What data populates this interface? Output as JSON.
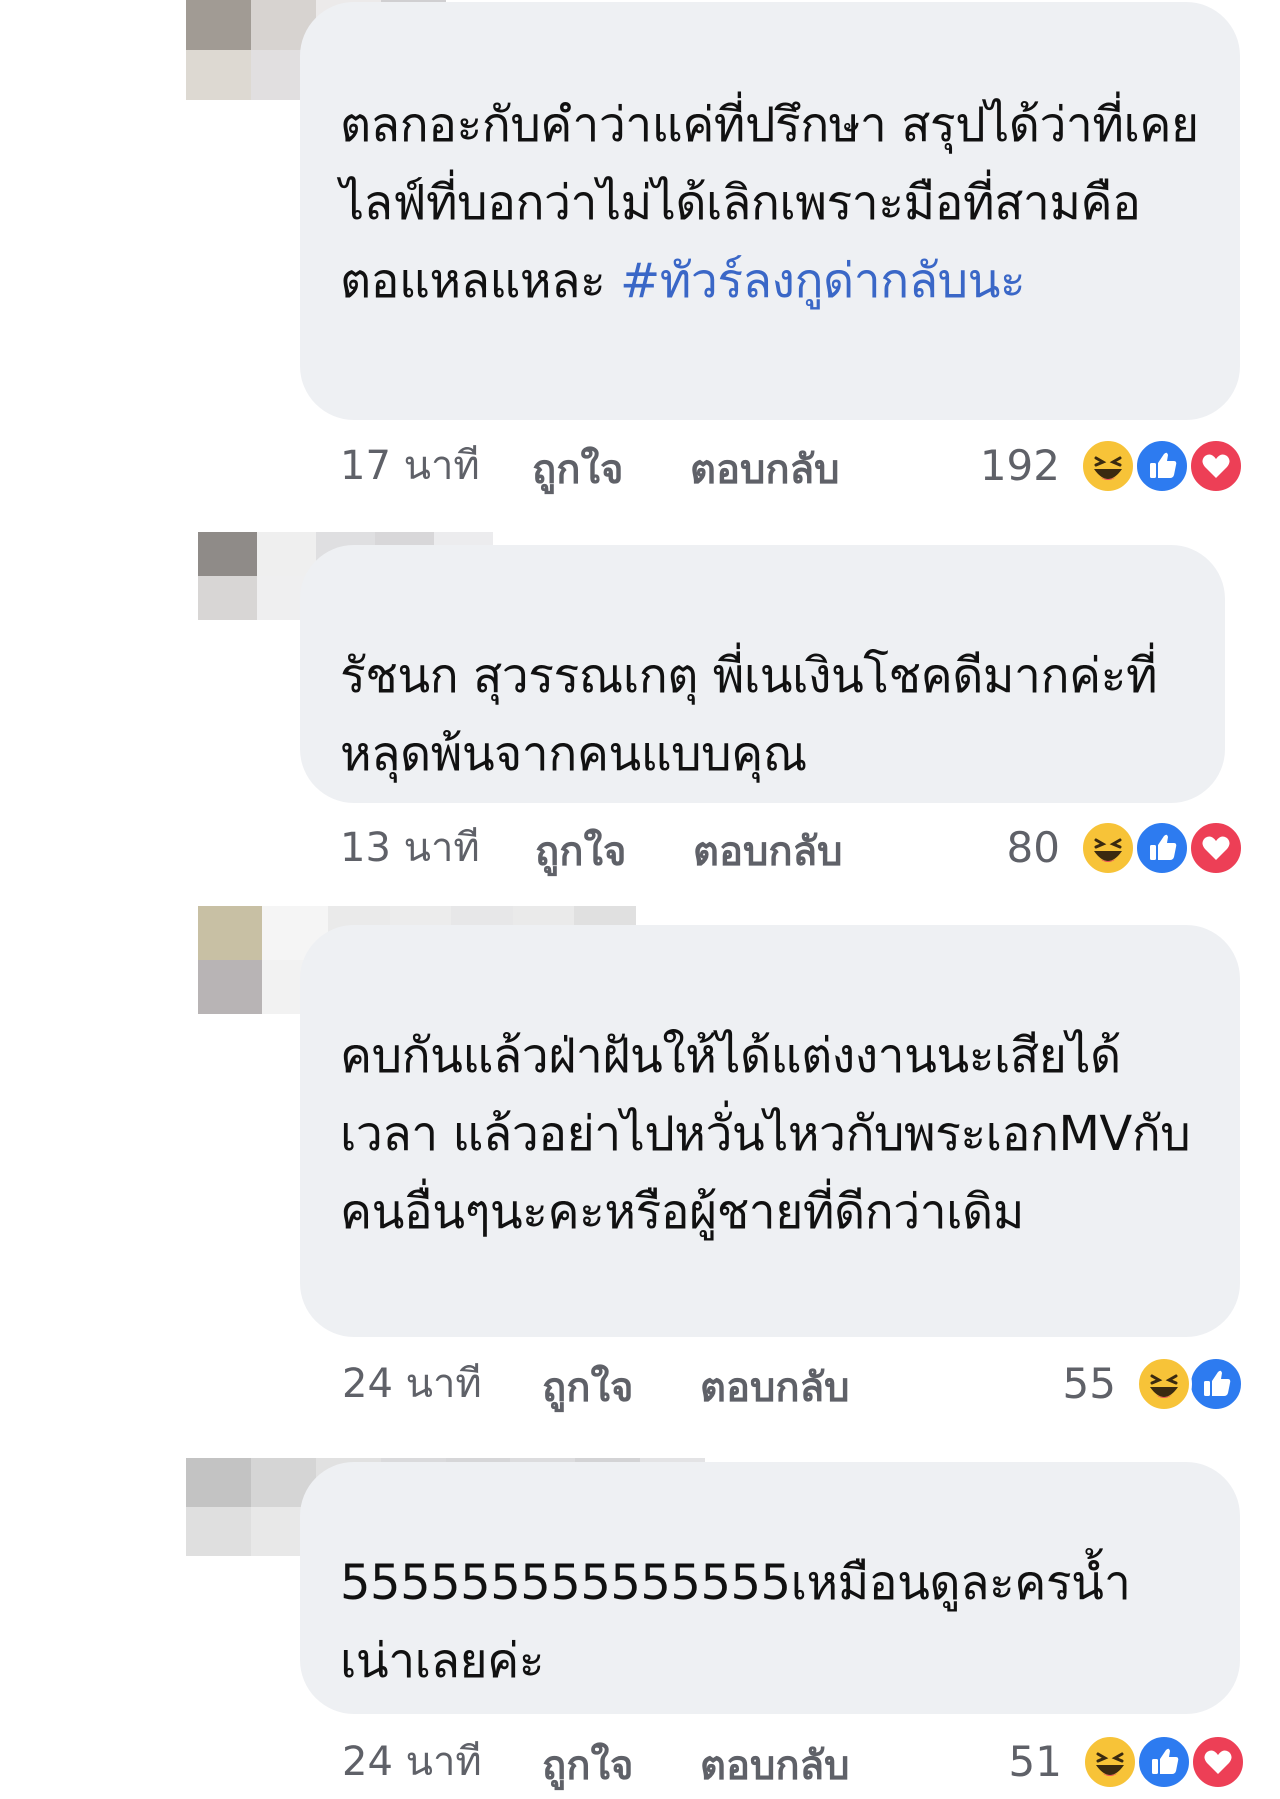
{
  "colors": {
    "bubble": "#eef0f3",
    "text": "#111111",
    "meta": "#5f6168",
    "hashtag": "#3a67c7",
    "haha": "#f7c338",
    "like": "#2d7bf0",
    "love": "#ed3f56"
  },
  "comments": [
    {
      "name_pixel_blocks": [
        "#a19b94",
        "#d7d3d0",
        "#eceaea",
        "#d0cfd1",
        "#ddd9d2",
        "#e1dfe0",
        "#eceaec",
        "#d1d0d2"
      ],
      "text_plain": "ตลกอะกับคำว่าแค่ที่ปรึกษา สรุปได้ว่าที่เคยไลฟ์ที่บอกว่าไม่ได้เลิกเพราะมือที่สามคือตอแหลแหละ ",
      "hashtag": "#ทัวร์ลงกูด่ากลับนะ",
      "time": "17 นาที",
      "like_label": "ถูกใจ",
      "reply_label": "ตอบกลับ",
      "reaction_count": "192",
      "reactions": [
        "haha-icon",
        "like-icon",
        "love-icon"
      ]
    },
    {
      "name_pixel_blocks": [
        "#8f8b88",
        "#efefef",
        "#dfdfe1",
        "#d8d7d9",
        "#ececee",
        "#d8d6d5",
        "#efeff0",
        "#b5b4b8",
        "#cfcdd0",
        "#e0dfe1"
      ],
      "text_plain": "รัชนก สุวรรณเกตุ พี่เนเงินโชคดีมากค่ะที่หลุดพ้นจากคนแบบคุณ",
      "hashtag": "",
      "time": "13 นาที",
      "like_label": "ถูกใจ",
      "reply_label": "ตอบกลับ",
      "reaction_count": "80",
      "reactions": [
        "haha-icon",
        "like-icon",
        "love-icon"
      ]
    },
    {
      "name_pixel_blocks": [
        "#c8c0a4",
        "#f5f5f5",
        "#eaeaea",
        "#ececec",
        "#e7e7e8",
        "#eaeaea",
        "#e0e0e0",
        "#b8b4b5",
        "#f2f2f2",
        "#b9b9b9",
        "#a8a8a8",
        "#a9a9aa",
        "#b2b2b3",
        "#c3c3c3"
      ],
      "text_plain": "คบกันแล้วฝ่าฝันให้ได้แต่งงานนะเสียได้เวลา แล้วอย่าไปหวั่นไหวกับพระเอกMVกับคนอื่นๆนะคะหรือผู้ชายที่ดีกว่าเดิม",
      "hashtag": "",
      "time": "24 นาที",
      "like_label": "ถูกใจ",
      "reply_label": "ตอบกลับ",
      "reaction_count": "55",
      "reactions": [
        "haha-icon",
        "like-icon"
      ]
    },
    {
      "name_pixel_blocks": [
        "#c3c3c3",
        "#d5d5d5",
        "#e1e1e1",
        "#dadadc",
        "#d6d6d8",
        "#dcdcde",
        "#d3d3d5",
        "#e3e3e5",
        "#dfdfdf",
        "#e8e8e8",
        "#d7d7d9",
        "#d1d1d3",
        "#cfcfd1",
        "#d5d5d7",
        "#cfcfd1",
        "#dddddf"
      ],
      "text_plain": "555555555555555เหมือนดูละครน้ำเน่าเลยค่ะ",
      "hashtag": "",
      "time": "24 นาที",
      "like_label": "ถูกใจ",
      "reply_label": "ตอบกลับ",
      "reaction_count": "51",
      "reactions": [
        "haha-icon",
        "like-icon",
        "love-icon"
      ]
    }
  ]
}
